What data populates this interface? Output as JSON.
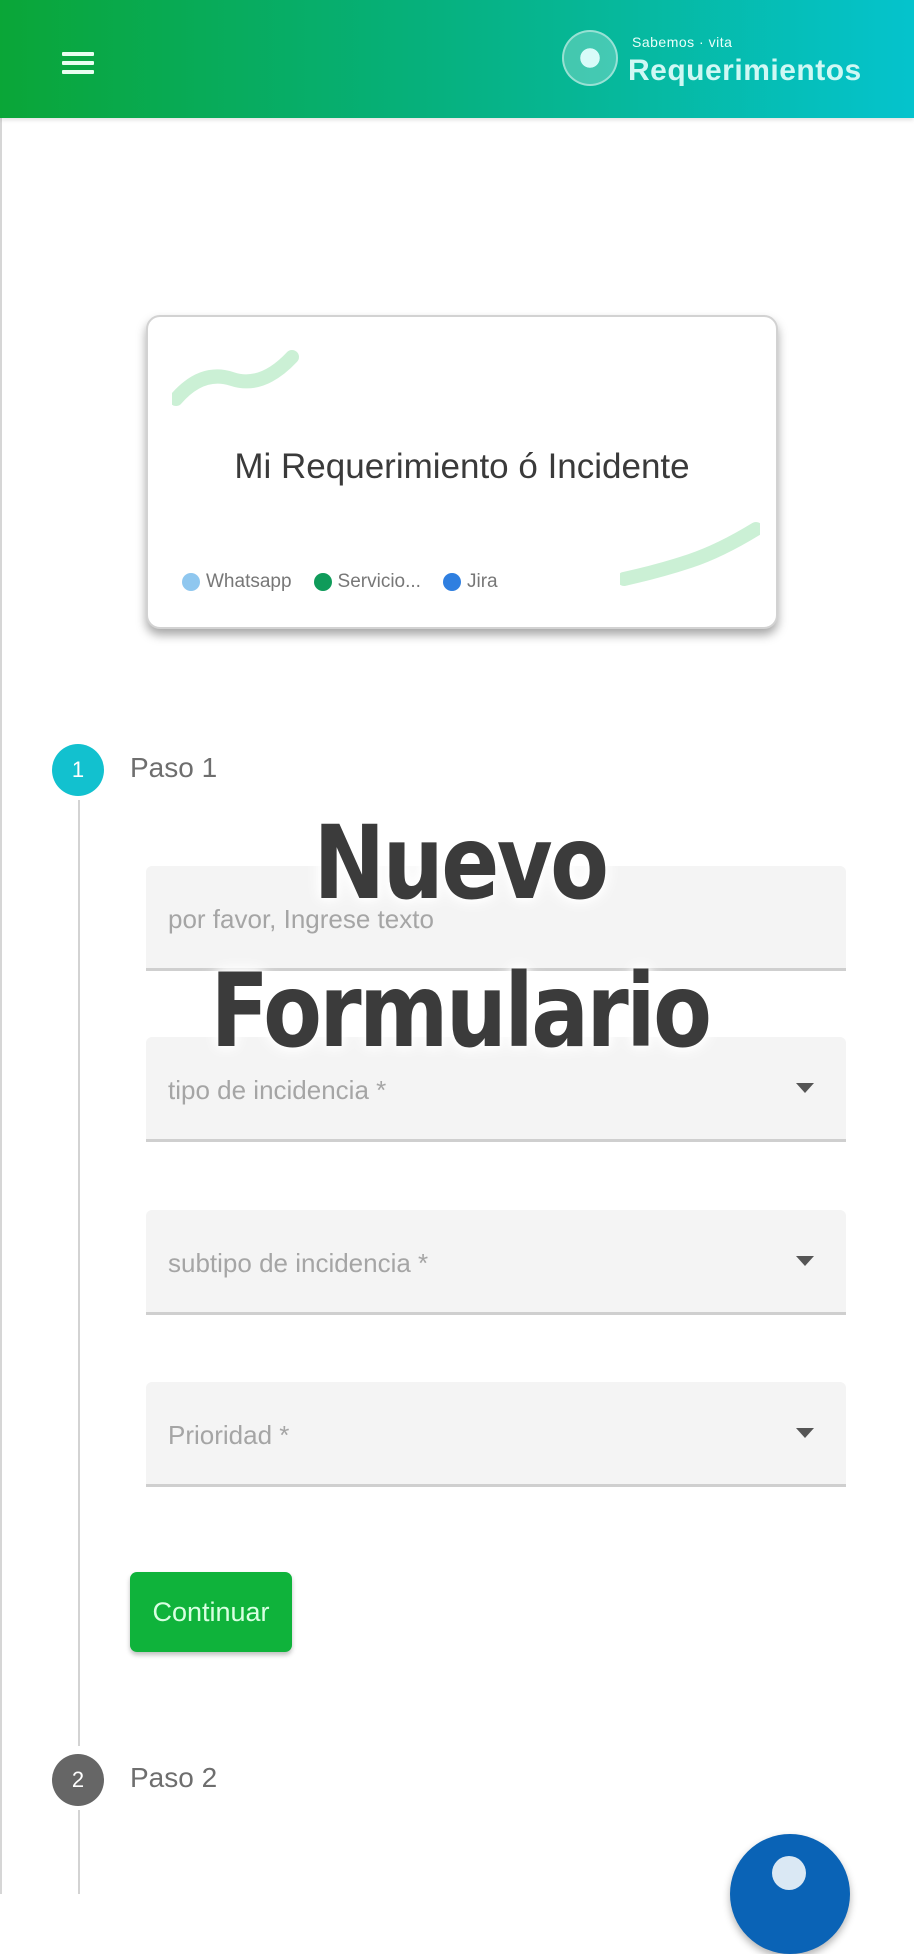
{
  "header": {
    "brand_small": "Sabemos · vita",
    "brand_name": "Requerimientos"
  },
  "card": {
    "title": "Mi Requerimiento ó Incidente",
    "links": [
      {
        "label": "Whatsapp",
        "color": "#8fc7ef",
        "icon": "info-icon"
      },
      {
        "label": "Servicio...",
        "color": "#0f9b5a",
        "icon": "chat-icon"
      },
      {
        "label": "Jira",
        "color": "#2f7fe0",
        "icon": "jira-icon"
      }
    ]
  },
  "steps": [
    {
      "number": "1",
      "label": "Paso 1",
      "color": "#12c1cf"
    },
    {
      "number": "2",
      "label": "Paso 2",
      "color": "#666666"
    }
  ],
  "form": {
    "description_placeholder": "por favor, Ingrese texto",
    "incident_type_placeholder": "tipo de incidencia *",
    "incident_subtype_placeholder": "subtipo de incidencia *",
    "priority_placeholder": "Prioridad *",
    "continue_label": "Continuar"
  },
  "overlay": {
    "line1": "Nuevo",
    "line2": "Formulario"
  },
  "colors": {
    "header_start": "#0aa637",
    "header_end": "#05c3cd",
    "primary_button": "#0fb33b",
    "fab": "#0a63b6"
  }
}
